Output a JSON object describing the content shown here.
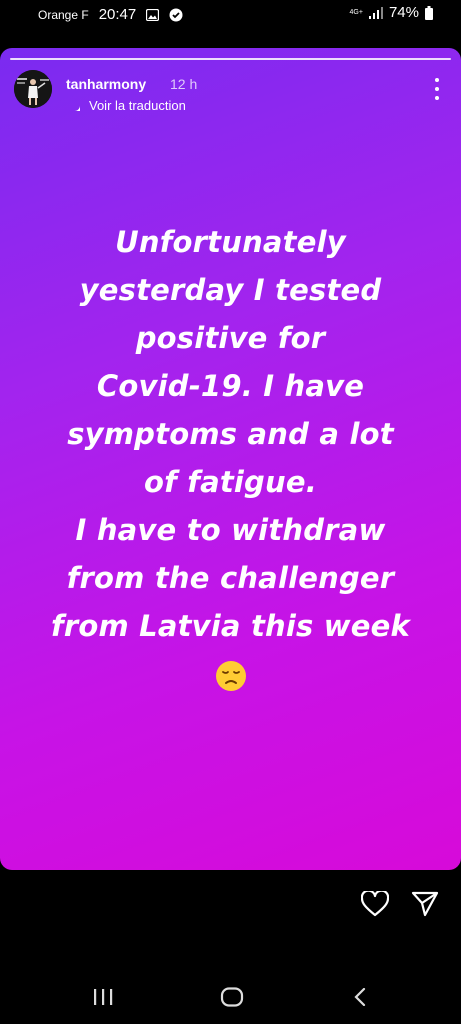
{
  "status_bar": {
    "carrier": "Orange F",
    "time": "20:47",
    "network": "4G+",
    "battery": "74%"
  },
  "story": {
    "username": "tanharmony",
    "time_ago": "12 h",
    "translate_label": "Voir la traduction",
    "text_lines": [
      "Unfortunately",
      "yesterday I tested",
      "positive for",
      "Covid-19.  I have",
      "symptoms and a lot",
      "of fatigue.",
      "I have to withdraw",
      "from the challenger",
      "from Latvia this week"
    ],
    "emoji": "disappointed-face-emoji",
    "gradient_colors": [
      "#7a2bf0",
      "#a224ee",
      "#c713e6",
      "#d70ad9"
    ]
  },
  "actions": {
    "icons": [
      "heart-icon",
      "share-icon"
    ]
  },
  "navbar": {
    "icons": [
      "recent-apps-icon",
      "home-icon",
      "back-icon"
    ]
  }
}
